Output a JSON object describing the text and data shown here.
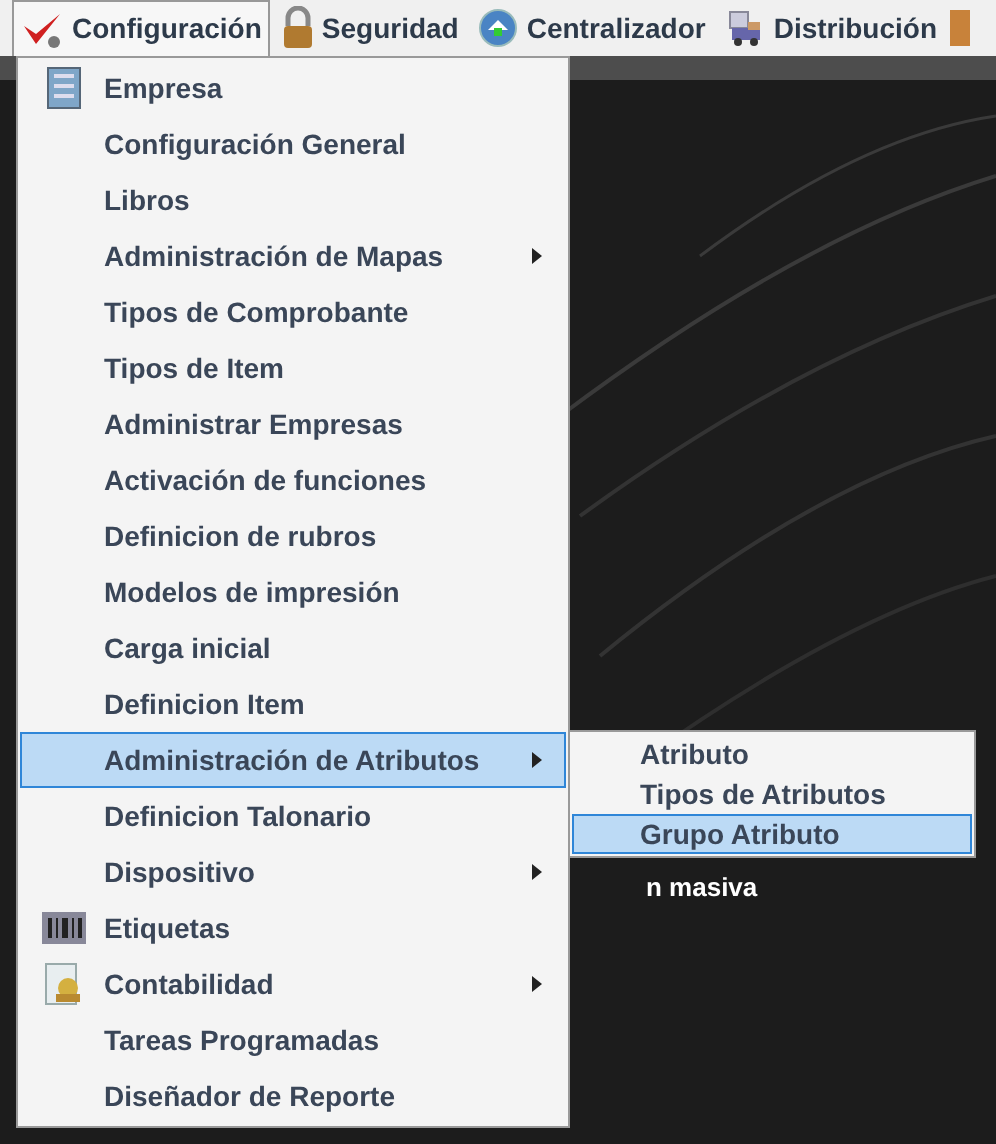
{
  "menubar": [
    {
      "label": "Configuración",
      "selected": true
    },
    {
      "label": "Seguridad",
      "selected": false
    },
    {
      "label": "Centralizador",
      "selected": false
    },
    {
      "label": "Distribución",
      "selected": false
    }
  ],
  "menu": [
    {
      "label": "Empresa",
      "has_icon": true,
      "submenu": false,
      "selected": false
    },
    {
      "label": "Configuración General",
      "has_icon": false,
      "submenu": false,
      "selected": false
    },
    {
      "label": "Libros",
      "has_icon": false,
      "submenu": false,
      "selected": false
    },
    {
      "label": "Administración de Mapas",
      "has_icon": false,
      "submenu": true,
      "selected": false
    },
    {
      "label": "Tipos de Comprobante",
      "has_icon": false,
      "submenu": false,
      "selected": false
    },
    {
      "label": "Tipos de Item",
      "has_icon": false,
      "submenu": false,
      "selected": false
    },
    {
      "label": "Administrar Empresas",
      "has_icon": false,
      "submenu": false,
      "selected": false
    },
    {
      "label": "Activación de funciones",
      "has_icon": false,
      "submenu": false,
      "selected": false
    },
    {
      "label": "Definicion de rubros",
      "has_icon": false,
      "submenu": false,
      "selected": false
    },
    {
      "label": "Modelos de impresión",
      "has_icon": false,
      "submenu": false,
      "selected": false
    },
    {
      "label": "Carga inicial",
      "has_icon": false,
      "submenu": false,
      "selected": false
    },
    {
      "label": "Definicion Item",
      "has_icon": false,
      "submenu": false,
      "selected": false
    },
    {
      "label": "Administración de Atributos",
      "has_icon": false,
      "submenu": true,
      "selected": true
    },
    {
      "label": "Definicion Talonario",
      "has_icon": false,
      "submenu": false,
      "selected": false
    },
    {
      "label": "Dispositivo",
      "has_icon": false,
      "submenu": true,
      "selected": false
    },
    {
      "label": "Etiquetas",
      "has_icon": true,
      "submenu": false,
      "selected": false
    },
    {
      "label": "Contabilidad",
      "has_icon": true,
      "submenu": true,
      "selected": false
    },
    {
      "label": "Tareas Programadas",
      "has_icon": false,
      "submenu": false,
      "selected": false
    },
    {
      "label": "Diseñador de Reporte",
      "has_icon": false,
      "submenu": false,
      "selected": false
    }
  ],
  "submenu": [
    {
      "label": "Atributo",
      "selected": false
    },
    {
      "label": "Tipos de Atributos",
      "selected": false
    },
    {
      "label": "Grupo Atributo",
      "selected": true
    }
  ],
  "background_text": "n masiva"
}
